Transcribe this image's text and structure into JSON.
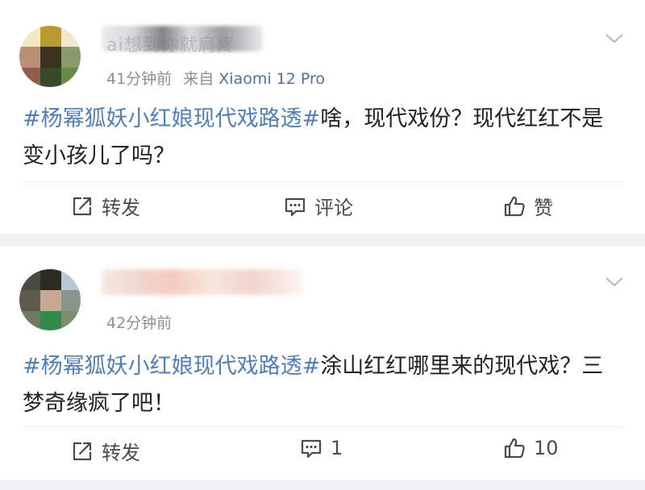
{
  "posts": [
    {
      "username": "ai想到你就肩疼",
      "time": "41分钟前",
      "via_prefix": "来自",
      "device": "Xiaomi 12 Pro",
      "hashtag": "#杨幂狐妖小红娘现代戏路透#",
      "text": "啥，现代戏份？现代红红不是变小孩儿了吗？",
      "actions": {
        "repost": "转发",
        "comment": "评论",
        "like": "赞"
      }
    },
    {
      "time": "42分钟前",
      "hashtag": "#杨幂狐妖小红娘现代戏路透#",
      "text": "涂山红红哪里来的现代戏？三梦奇缘疯了吧！",
      "actions": {
        "repost": "转发",
        "comment": "1",
        "like": "10"
      }
    }
  ],
  "colors": {
    "link": "#4f7ec0",
    "device": "#4f6fa8",
    "meta": "#8e8e93",
    "background": "#f1f1f3"
  },
  "icons": {
    "repost": "share-square-icon",
    "comment": "comment-icon",
    "like": "thumbs-up-icon",
    "menu": "chevron-down-icon"
  }
}
